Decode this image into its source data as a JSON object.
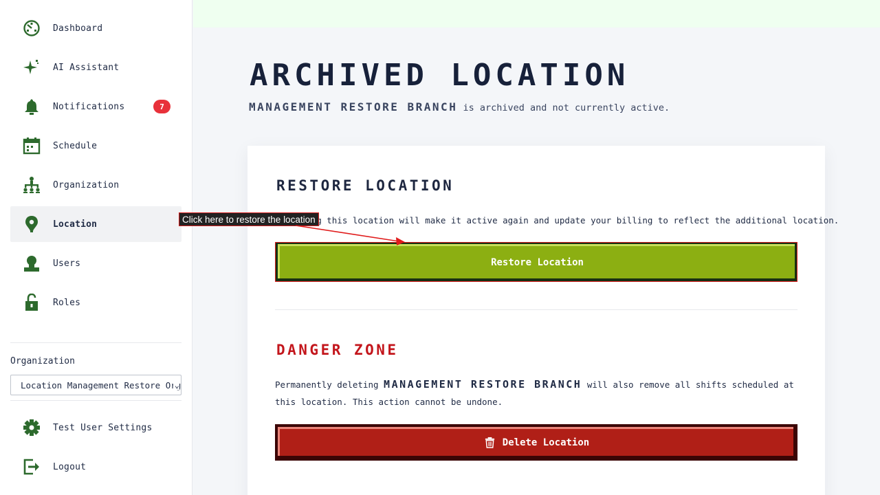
{
  "sidebar": {
    "items": [
      {
        "label": "Dashboard",
        "icon": "dashboard-icon"
      },
      {
        "label": "AI Assistant",
        "icon": "sparkle-icon"
      },
      {
        "label": "Notifications",
        "icon": "bell-icon",
        "badge": "7"
      },
      {
        "label": "Schedule",
        "icon": "calendar-icon"
      },
      {
        "label": "Organization",
        "icon": "org-chart-icon"
      },
      {
        "label": "Location",
        "icon": "location-pin-icon",
        "active": true
      },
      {
        "label": "Users",
        "icon": "user-icon"
      },
      {
        "label": "Roles",
        "icon": "lock-icon"
      }
    ],
    "org_label": "Organization",
    "org_select_value": "Location Management Restore Org",
    "bottom_items": [
      {
        "label": "Test User Settings",
        "icon": "gear-icon"
      },
      {
        "label": "Logout",
        "icon": "logout-icon"
      }
    ]
  },
  "page": {
    "title": "Archived Location",
    "subtitle_name": "Management Restore Branch",
    "subtitle_rest": " is archived and not currently active."
  },
  "restore": {
    "title": "Restore Location",
    "text": "Restoring this location will make it active again and update your billing to reflect the additional location.",
    "button_label": "Restore Location"
  },
  "danger": {
    "title": "Danger Zone",
    "text_before": "Permanently deleting ",
    "text_name": "Management Restore Branch",
    "text_after": " will also remove all shifts scheduled at this location. This action cannot be undone.",
    "button_label": "Delete Location"
  },
  "annotation": {
    "tooltip": "Click here to restore the location"
  },
  "colors": {
    "accent_green": "#8caf12",
    "danger_red": "#b01f17",
    "badge_red": "#e8313a",
    "icon_green": "#2d6a2d"
  }
}
